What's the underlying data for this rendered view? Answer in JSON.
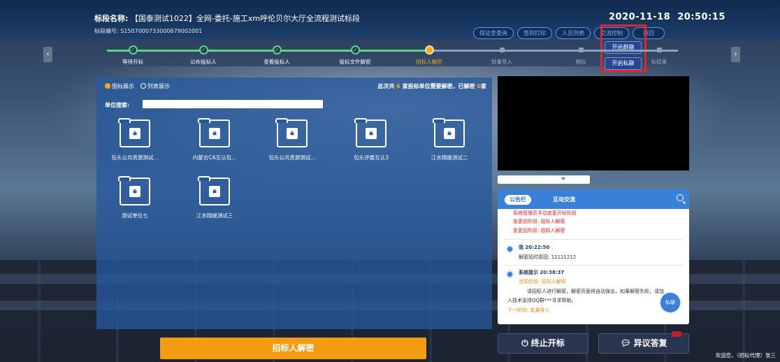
{
  "header": {
    "name_label": "标段名称:",
    "name_value": "【国泰测试1022】全网-委托-施工xm呼伦贝尔大厅全流程测试标段",
    "code_label": "标段编号:",
    "code_value": "S1507000733000679002001",
    "date": "2020-11-18",
    "time": "20:50:15",
    "buttons": [
      "保证金查询",
      "签到打印",
      "人员列表",
      "交流控制",
      "返回"
    ]
  },
  "popup": {
    "group_chat": "开启群聊",
    "private_chat": "开启私聊"
  },
  "steps": [
    {
      "label": "等待开标",
      "state": "done"
    },
    {
      "label": "公布投标人",
      "state": "done"
    },
    {
      "label": "查看投标人",
      "state": "done"
    },
    {
      "label": "投标文件解密",
      "state": "done"
    },
    {
      "label": "招标人解密",
      "state": "active"
    },
    {
      "label": "批量导入",
      "state": "todo"
    },
    {
      "label": "唱标",
      "state": "todo"
    },
    {
      "label": "标结束",
      "state": "todo"
    }
  ],
  "panel": {
    "view_icon": "图标展示",
    "view_list": "列表展示",
    "summary_pre": "此次共",
    "summary_total": "6",
    "summary_mid": "家投标单位需要解密，已解密",
    "summary_done": "0",
    "summary_post": "家",
    "search_label": "单位搜索:",
    "search_value": ""
  },
  "folders": [
    "包头公共资源测试...",
    "内蒙古CA互认包...",
    "包头公共资源测试...",
    "包头评委互认3",
    "江水翔晟测试二",
    "测试单位七",
    "江水翔晟测试三"
  ],
  "decrypt_button": "招标人解密",
  "notice": {
    "tab_board": "公告栏",
    "tab_chat": "互动交流",
    "top_lines": [
      "系统管理员手动变更开标阶段",
      "变更前阶段: 招标人解密",
      "变更后阶段: 招标人解密"
    ],
    "msg1_who": "我 20:22:50",
    "msg1_text": "解密延时原因: 12121212",
    "msg2_who": "系统提示 20:38:37",
    "msg2_stage": "当前阶段: 招标人解密",
    "msg2_text1": "请招标人进行解密，解密页面将自动弹出，如果解密失败，请加",
    "msg2_text2": "入技术支持QQ群***寻求帮助。",
    "msg2_next": "下一阶段: 批量导入",
    "private_btn": "私聊"
  },
  "stop_button": "终止开标",
  "reply_button": "异议答复",
  "welcome": "欢迎您，（招标代理）张三"
}
